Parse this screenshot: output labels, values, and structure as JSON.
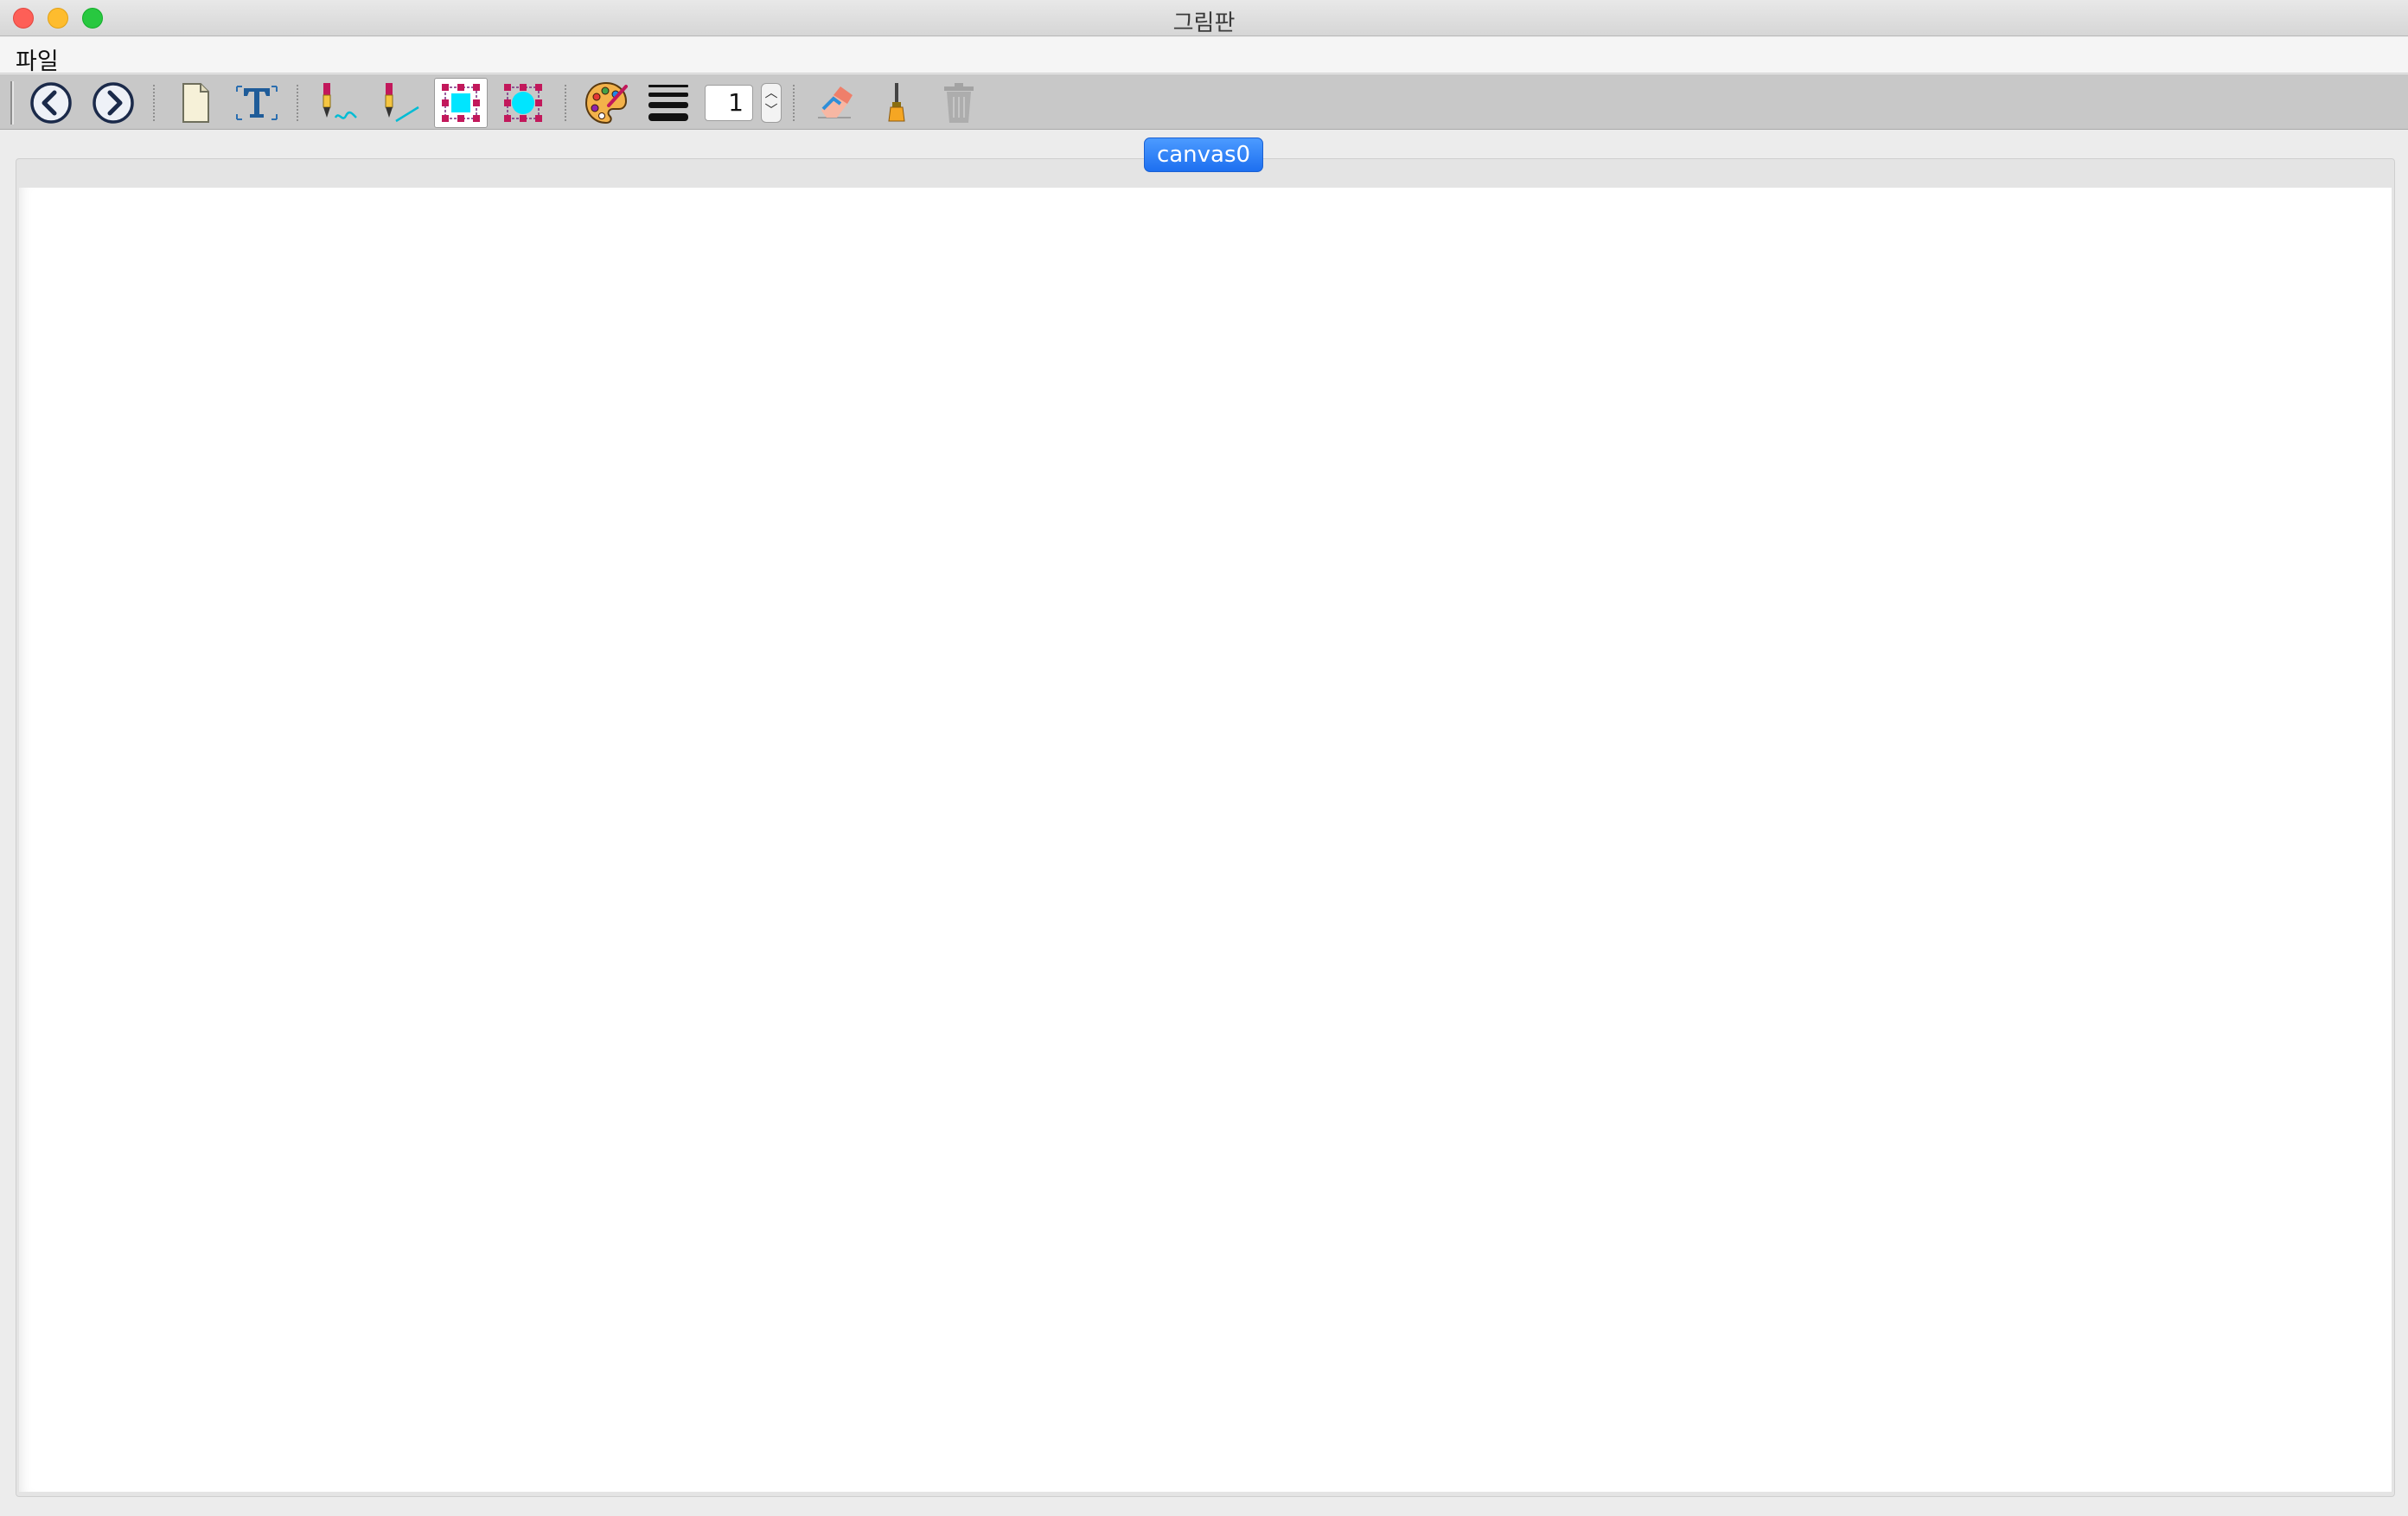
{
  "window": {
    "title": "그림판"
  },
  "menu": {
    "items": [
      {
        "label": "파일"
      }
    ]
  },
  "toolbar": {
    "buttons": [
      {
        "name": "undo",
        "icon": "back-arrow-icon"
      },
      {
        "name": "redo",
        "icon": "forward-arrow-icon"
      },
      {
        "name": "new",
        "icon": "new-page-icon"
      },
      {
        "name": "text",
        "icon": "text-tool-icon"
      },
      {
        "name": "freehand-pen",
        "icon": "freehand-pen-icon"
      },
      {
        "name": "line-pen",
        "icon": "line-pen-icon"
      },
      {
        "name": "rectangle",
        "icon": "rectangle-select-icon",
        "selected": true
      },
      {
        "name": "ellipse",
        "icon": "ellipse-select-icon"
      },
      {
        "name": "color",
        "icon": "palette-icon"
      },
      {
        "name": "line-width",
        "icon": "line-width-icon"
      },
      {
        "name": "eraser",
        "icon": "eraser-icon"
      },
      {
        "name": "fill",
        "icon": "brush-icon"
      },
      {
        "name": "delete",
        "icon": "trash-icon",
        "disabled": true
      }
    ],
    "stroke_width": "1"
  },
  "tabs": [
    {
      "label": "canvas0",
      "active": true
    }
  ],
  "colors": {
    "tab_active": "#2a7cf6",
    "accent_cyan": "#00e5ff",
    "accent_magenta": "#c2185b"
  }
}
